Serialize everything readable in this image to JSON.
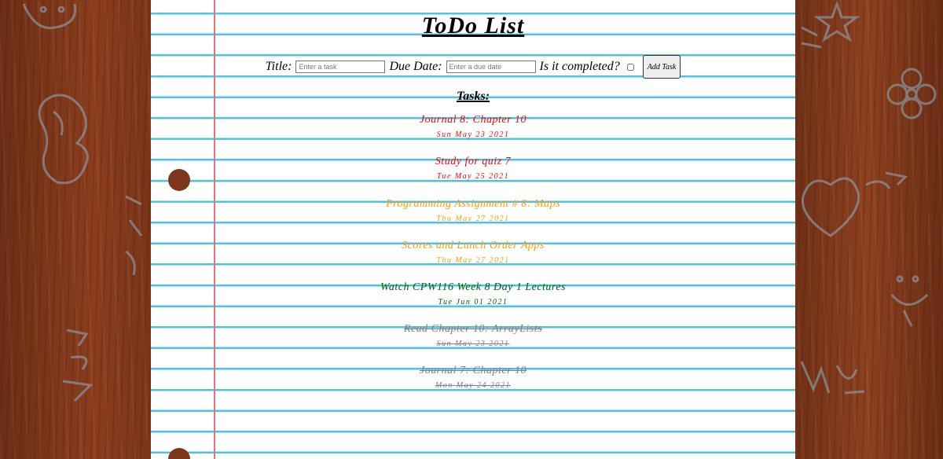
{
  "page": {
    "title": "ToDo List",
    "tasks_heading": "Tasks:"
  },
  "form": {
    "title_label": "Title:",
    "title_placeholder": "Enter a task",
    "due_label": "Due Date:",
    "due_placeholder": "Enter a due date",
    "completed_label": "Is it completed?",
    "completed_checked": false,
    "add_button": "Add Task"
  },
  "colors": {
    "overdue": "#ff0000",
    "soon": "#ff9900",
    "later": "#006400",
    "done": "#808080",
    "paper_lines": "#4cc3ec",
    "margin_line": "#e8707a"
  },
  "tasks": [
    {
      "title": "Journal 8: Chapter 10",
      "date": "Sun May 23 2021",
      "status": "overdue",
      "color": "#ff0000",
      "completed": false
    },
    {
      "title": "Study for quiz 7",
      "date": "Tue May 25 2021",
      "status": "overdue",
      "color": "#ff0000",
      "completed": false
    },
    {
      "title": "Programming Assignment # 8: Maps",
      "date": "Thu May 27 2021",
      "status": "soon",
      "color": "#ff9900",
      "completed": false
    },
    {
      "title": "Scores and Lunch Order Apps",
      "date": "Thu May 27 2021",
      "status": "soon",
      "color": "#ff9900",
      "completed": false
    },
    {
      "title": "Watch CPW116 Week 8 Day 1 Lectures",
      "date": "Tue Jun 01 2021",
      "status": "later",
      "color": "#006400",
      "completed": false
    },
    {
      "title": "Read Chapter 10: ArrayLists",
      "date": "Sun May 23 2021",
      "status": "done",
      "color": "#808080",
      "completed": true
    },
    {
      "title": "Journal 7: Chapter 10",
      "date": "Mon May 24 2021",
      "status": "done",
      "color": "#808080",
      "completed": true
    }
  ]
}
